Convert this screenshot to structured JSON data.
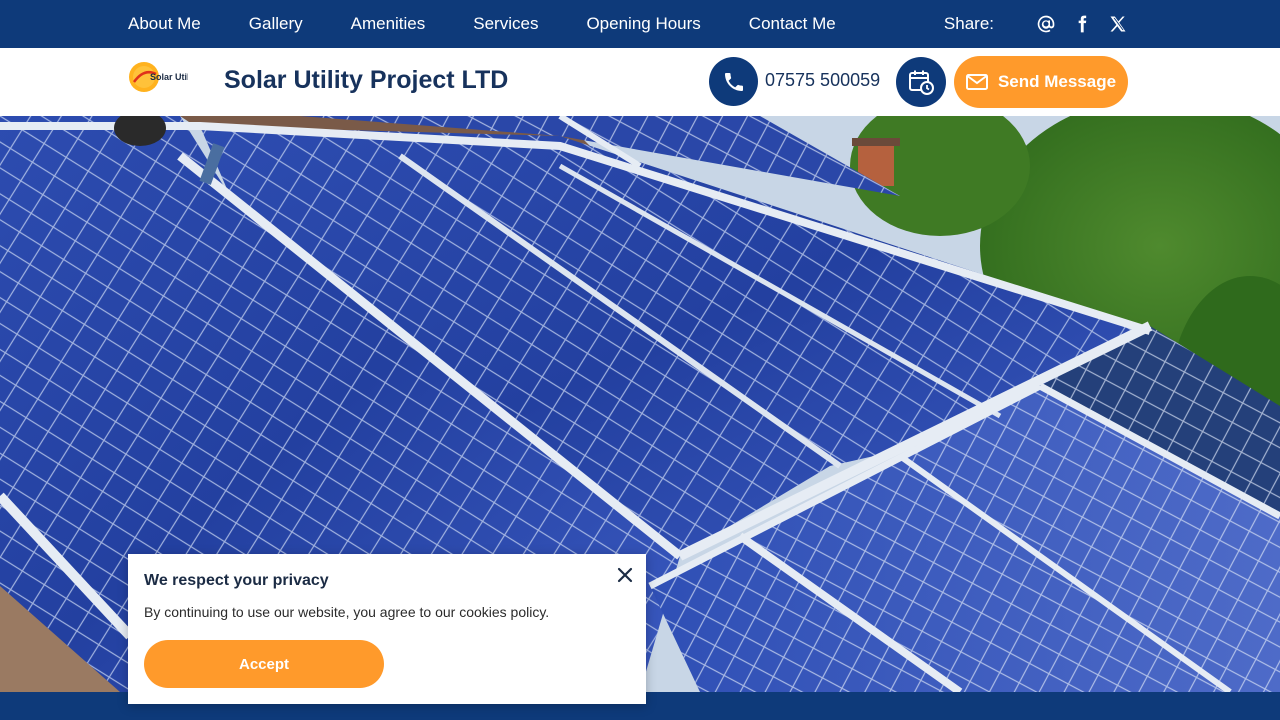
{
  "nav": {
    "items": [
      {
        "label": "About Me"
      },
      {
        "label": "Gallery"
      },
      {
        "label": "Amenities"
      },
      {
        "label": "Services"
      },
      {
        "label": "Opening Hours"
      },
      {
        "label": "Contact Me"
      }
    ],
    "share_label": "Share:",
    "social_icons": [
      "at-icon",
      "facebook-icon",
      "x-icon"
    ]
  },
  "header": {
    "logo_text": "Solar Utility",
    "site_title": "Solar Utility Project LTD",
    "phone_number": "07575 500059",
    "send_button_label": "Send Message"
  },
  "cookie": {
    "title": "We respect your privacy",
    "text": "By continuing to use our website, you agree to our cookies policy.",
    "accept_label": "Accept"
  },
  "colors": {
    "primary_navy": "#0e3a7a",
    "accent_orange": "#ff9a2b",
    "title_text": "#17325c"
  }
}
